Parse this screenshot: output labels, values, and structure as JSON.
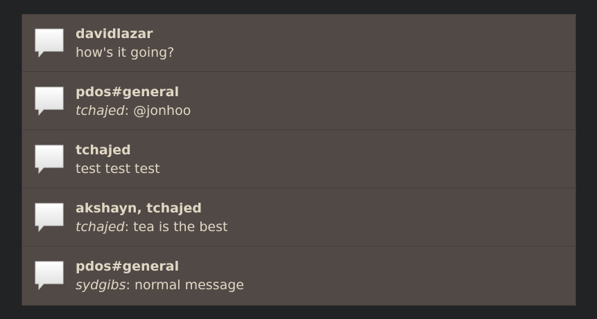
{
  "notifications": [
    {
      "title": "davidlazar",
      "author": "",
      "separator": "",
      "text": "how's it going?"
    },
    {
      "title": "pdos#general",
      "author": "tchajed",
      "separator": ": ",
      "text": "@jonhoo"
    },
    {
      "title": "tchajed",
      "author": "",
      "separator": "",
      "text": "test test test"
    },
    {
      "title": "akshayn, tchajed",
      "author": "tchajed",
      "separator": ": ",
      "text": "tea is the best"
    },
    {
      "title": "pdos#general",
      "author": "sydgibs",
      "separator": ": ",
      "text": "normal message"
    }
  ],
  "icon": "speech-bubble-icon",
  "colors": {
    "background": "#212325",
    "panel": "#514946",
    "divider": "#433c39",
    "text": "#e0d7c4",
    "bubble": "#f2f2f2"
  }
}
